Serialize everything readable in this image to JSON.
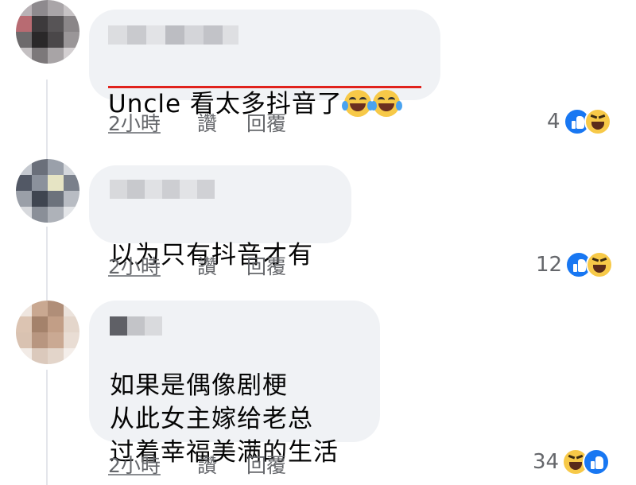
{
  "comments": [
    {
      "text": "Uncle 看太多抖音了",
      "emoji": [
        "rolling-on-floor-laughing",
        "rolling-on-floor-laughing"
      ],
      "time": "2小時",
      "like": "讚",
      "reply": "回覆",
      "reaction_count": "4",
      "reactions": [
        "like",
        "haha"
      ]
    },
    {
      "text": "以为只有抖音才有",
      "time": "2小時",
      "like": "讚",
      "reply": "回覆",
      "reaction_count": "12",
      "reactions": [
        "like",
        "haha"
      ]
    },
    {
      "text": "如果是偶像剧梗\n从此女主嫁给老总\n过着幸福美满的生活",
      "time": "2小時",
      "like": "讚",
      "reply": "回覆",
      "reaction_count": "34",
      "reactions": [
        "haha",
        "like"
      ]
    }
  ],
  "colors": {
    "bubble": "#f0f2f5",
    "meta_text": "#65676b",
    "underline": "#e0221c",
    "like_blue": "#1877f2",
    "haha_yellow": "#f7c948"
  }
}
